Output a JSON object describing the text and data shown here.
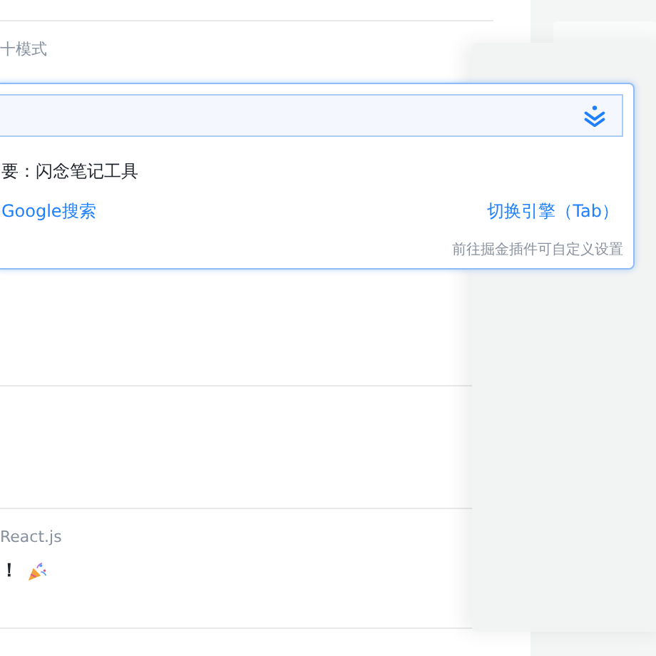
{
  "feed": [
    {
      "tag": "十模式"
    },
    {
      "tag": "React.js",
      "title": "！"
    }
  ],
  "search_popup": {
    "suggestion": "要：闪念笔记工具",
    "engine_link": "Google搜索",
    "switch_link": "切换引擎（Tab）",
    "hint": "前往掘金插件可自定义设置"
  }
}
